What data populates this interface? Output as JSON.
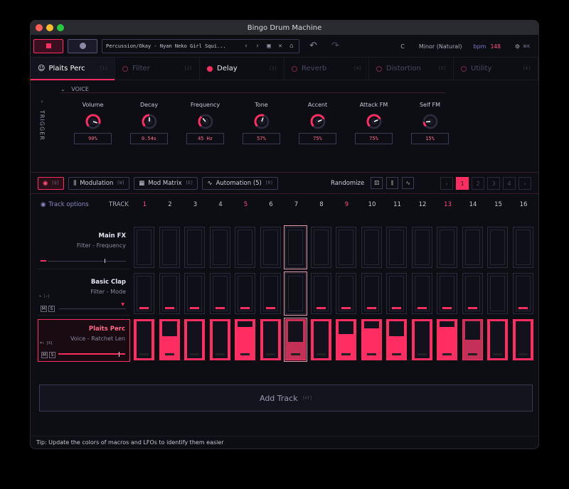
{
  "window": {
    "title": "Bingo Drum Machine"
  },
  "toolbar": {
    "preset": "Percussion/Okay - Nyan Neko Girl Squi...",
    "key": "C",
    "scale": "Minor (Natural)",
    "bpm_label": "bpm",
    "bpm_value": "148",
    "settings_key": "⌘K"
  },
  "tabs": [
    {
      "label": "Plaits Perc",
      "key": "[1]"
    },
    {
      "label": "Filter",
      "key": "[2]"
    },
    {
      "label": "Delay",
      "key": "[3]"
    },
    {
      "label": "Reverb",
      "key": "[4]"
    },
    {
      "label": "Distortion",
      "key": "[5]"
    },
    {
      "label": "Utility",
      "key": "[6]"
    }
  ],
  "voice": {
    "header": "VOICE",
    "trigger": "TRIGGER",
    "knobs": [
      {
        "label": "Volume",
        "value": "90%",
        "level": 0.9
      },
      {
        "label": "Decay",
        "value": "0.54s",
        "level": 0.5
      },
      {
        "label": "Frequency",
        "value": "45 Hz",
        "level": 0.35
      },
      {
        "label": "Tone",
        "value": "57%",
        "level": 0.57
      },
      {
        "label": "Accent",
        "value": "75%",
        "level": 0.75
      },
      {
        "label": "Attack FM",
        "value": "75%",
        "level": 0.75
      },
      {
        "label": "Self FM",
        "value": "15%",
        "level": 0.15
      }
    ]
  },
  "toolbar2": {
    "eye_key": "[Q]",
    "modulation": "Modulation",
    "modulation_key": "[W]",
    "mod_matrix": "Mod Matrix",
    "mod_matrix_key": "[E]",
    "automation": "Automation (5)",
    "automation_key": "[R]",
    "randomize": "Randomize",
    "pages": [
      "1",
      "2",
      "3",
      "4"
    ]
  },
  "sequencer": {
    "track_options": "Track options",
    "track_label": "TRACK",
    "steps": [
      "1",
      "2",
      "3",
      "4",
      "5",
      "6",
      "7",
      "8",
      "9",
      "10",
      "11",
      "12",
      "13",
      "14",
      "15",
      "16"
    ],
    "accent_steps": [
      1,
      5,
      9,
      13
    ],
    "tracks": [
      {
        "name": "Main FX",
        "sub": "Filter - Frequency"
      },
      {
        "name": "Basic Clap",
        "sub": "Filter - Mode",
        "tag": "⇆ [↗]",
        "m": "M",
        "s": "S"
      },
      {
        "name": "Plaits Perc",
        "sub": "Voice - Ratchet Len",
        "tag": "⌘↑ [X]",
        "m": "M",
        "s": "S"
      }
    ],
    "clap_steps": [
      1,
      1,
      1,
      1,
      1,
      1,
      0,
      1,
      1,
      1,
      1,
      1,
      1,
      1,
      0,
      1
    ],
    "perc_fill": [
      0,
      0.6,
      0,
      0,
      0.85,
      0,
      0.45,
      0,
      0.65,
      0.8,
      0.6,
      0,
      0.85,
      0.5,
      0,
      0
    ]
  },
  "add_track": {
    "label": "Add Track",
    "key": "[⌘T]"
  },
  "status": {
    "tip": "Tip: Update the colors of macros and LFOs to identify them easier"
  },
  "colors": {
    "accent": "#ff2d62",
    "bg": "#0d0d14"
  }
}
